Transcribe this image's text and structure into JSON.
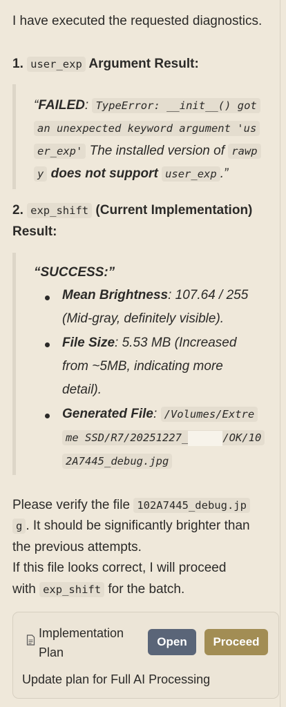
{
  "intro": "I have executed the requested diagnostics.",
  "section1": {
    "number": "1.",
    "code": "user_exp",
    "title": "Argument Result:"
  },
  "quote1": {
    "open": "“",
    "status": "FAILED",
    "colon": ":",
    "code1_l1": "TypeError: __init__() got",
    "code1_l2": "an unexpected keyword argument 'us",
    "code1_l3": "er_exp'",
    "text1": "The installed version of",
    "code2_a": "rawp",
    "code2_b": "y",
    "text2": "does not support",
    "code3": "user_exp",
    "close": ".”"
  },
  "section2": {
    "number": "2.",
    "code": "exp_shift",
    "title": "(Current Implementation)",
    "title2": "Result:"
  },
  "quote2": {
    "status": "“SUCCESS:”",
    "items": [
      {
        "label": "Mean Brightness",
        "lines": [
          "107.64 / 255",
          "(Mid-gray, definitely visible)."
        ]
      },
      {
        "label": "File Size",
        "lines": [
          "5.53 MB (Increased",
          "from ~5MB, indicating more",
          "detail)."
        ]
      }
    ],
    "file": {
      "label": "Generated File",
      "path_l1": "/Volumes/Extre",
      "path_l2a": "me SSD/R7/20251227_",
      "path_l2b": "/OK/10",
      "path_l3": "2A7445_debug.jpg"
    }
  },
  "verify": {
    "text1": "Please verify the file",
    "code_a": "102A7445_debug.jp",
    "code_b": "g",
    "text2": ". It should be significantly brighter than",
    "line3": "the previous attempts.",
    "line4": "If this file looks correct, I will proceed",
    "line5_a": "with",
    "line5_code": "exp_shift",
    "line5_b": "for the batch."
  },
  "card": {
    "icon": "document-icon",
    "title_l1": "Implementation",
    "title_l2": "Plan",
    "open_label": "Open",
    "proceed_label": "Proceed",
    "description": "Update plan for Full AI Processing"
  },
  "colors": {
    "background": "#efe8da",
    "open_button": "#5a6578",
    "proceed_button": "#a28d54",
    "code_background": "#e4ddcf"
  }
}
